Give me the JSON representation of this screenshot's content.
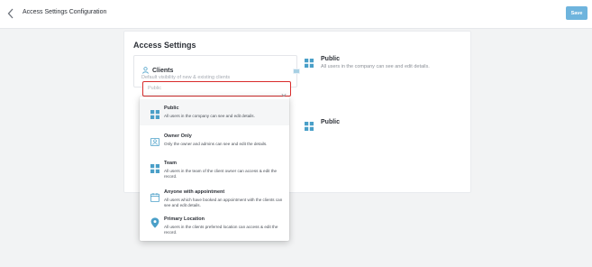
{
  "header": {
    "title": "Access Settings Configuration",
    "save_label": "Save"
  },
  "card": {
    "title": "Access Settings",
    "section": {
      "label": "Clients",
      "default_label": "Default visibility of new & existing clients",
      "select_value": "Public"
    },
    "right_options": [
      {
        "title": "Public",
        "desc": "All users in the company can see and edit details."
      },
      {
        "title": "Public",
        "desc": ""
      }
    ]
  },
  "dropdown": {
    "options": [
      {
        "title": "Public",
        "desc": "All users in the company can see and edit details.",
        "icon": "grid-icon"
      },
      {
        "title": "Owner Only",
        "desc": "Only the owner and admins can see and edit the details.",
        "icon": "owner-icon"
      },
      {
        "title": "Team",
        "desc": "All users in the team of the client owner can access & edit the record.",
        "icon": "team-icon"
      },
      {
        "title": "Anyone with appointment",
        "desc": "All users which have booked an appointment with the clients can see and edit details.",
        "icon": "calendar-icon"
      },
      {
        "title": "Primary Location",
        "desc": "All users in the clients preferred location can access & edit the record.",
        "icon": "location-pin-icon"
      }
    ]
  },
  "colors": {
    "accent": "#4a9fc8",
    "save_bg": "#6eb4dd",
    "highlight_border": "#d92c2c"
  }
}
